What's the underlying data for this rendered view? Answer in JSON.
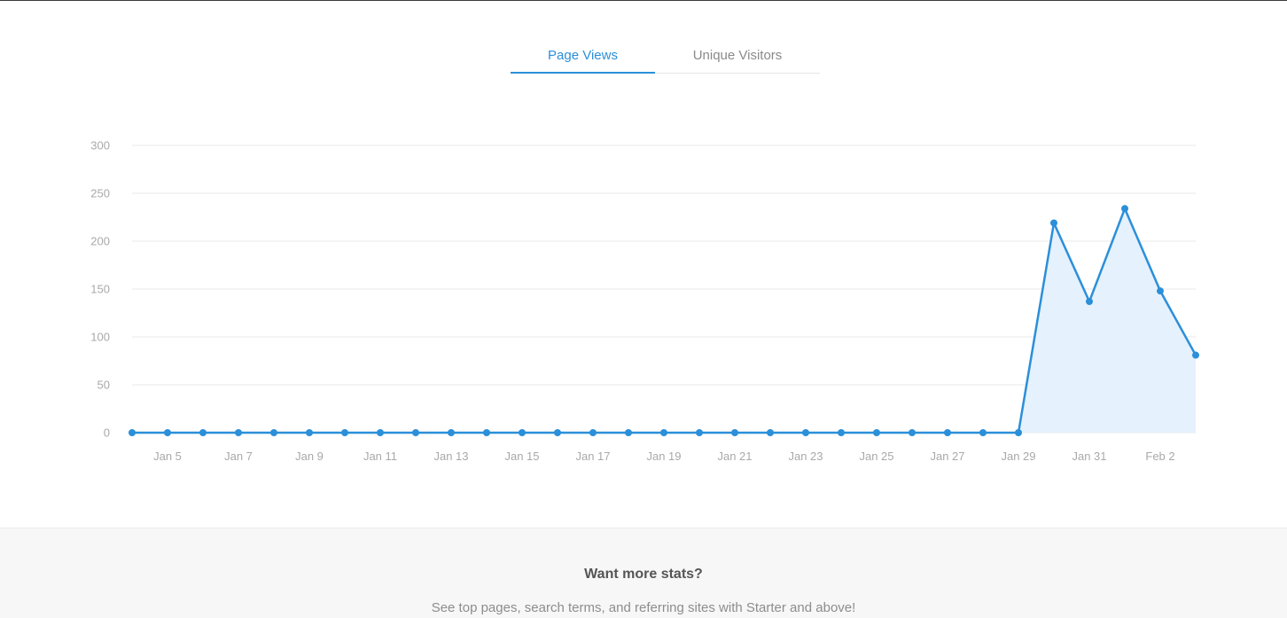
{
  "tabs": {
    "page_views": "Page Views",
    "unique_visitors": "Unique Visitors",
    "active": "page_views"
  },
  "chart_data": {
    "type": "area",
    "series": [
      {
        "values": [
          0,
          0,
          0,
          0,
          0,
          0,
          0,
          0,
          0,
          0,
          0,
          0,
          0,
          0,
          0,
          0,
          0,
          0,
          0,
          0,
          0,
          0,
          0,
          0,
          0,
          0,
          219,
          137,
          234,
          148,
          81
        ]
      }
    ],
    "x_labels": [
      "Jan 5",
      "Jan 7",
      "Jan 9",
      "Jan 11",
      "Jan 13",
      "Jan 15",
      "Jan 17",
      "Jan 19",
      "Jan 21",
      "Jan 23",
      "Jan 25",
      "Jan 27",
      "Jan 29",
      "Jan 31",
      "Feb 2"
    ],
    "y_ticks": [
      0,
      50,
      100,
      150,
      200,
      250,
      300
    ],
    "ylim": [
      0,
      300
    ],
    "grid": true,
    "line_color": "#2b8fd9",
    "fill_color": "#e5f1fc",
    "grid_color": "#e8e8e8"
  },
  "footer": {
    "title": "Want more stats?",
    "subtitle": "See top pages, search terms, and referring sites with Starter and above!"
  }
}
